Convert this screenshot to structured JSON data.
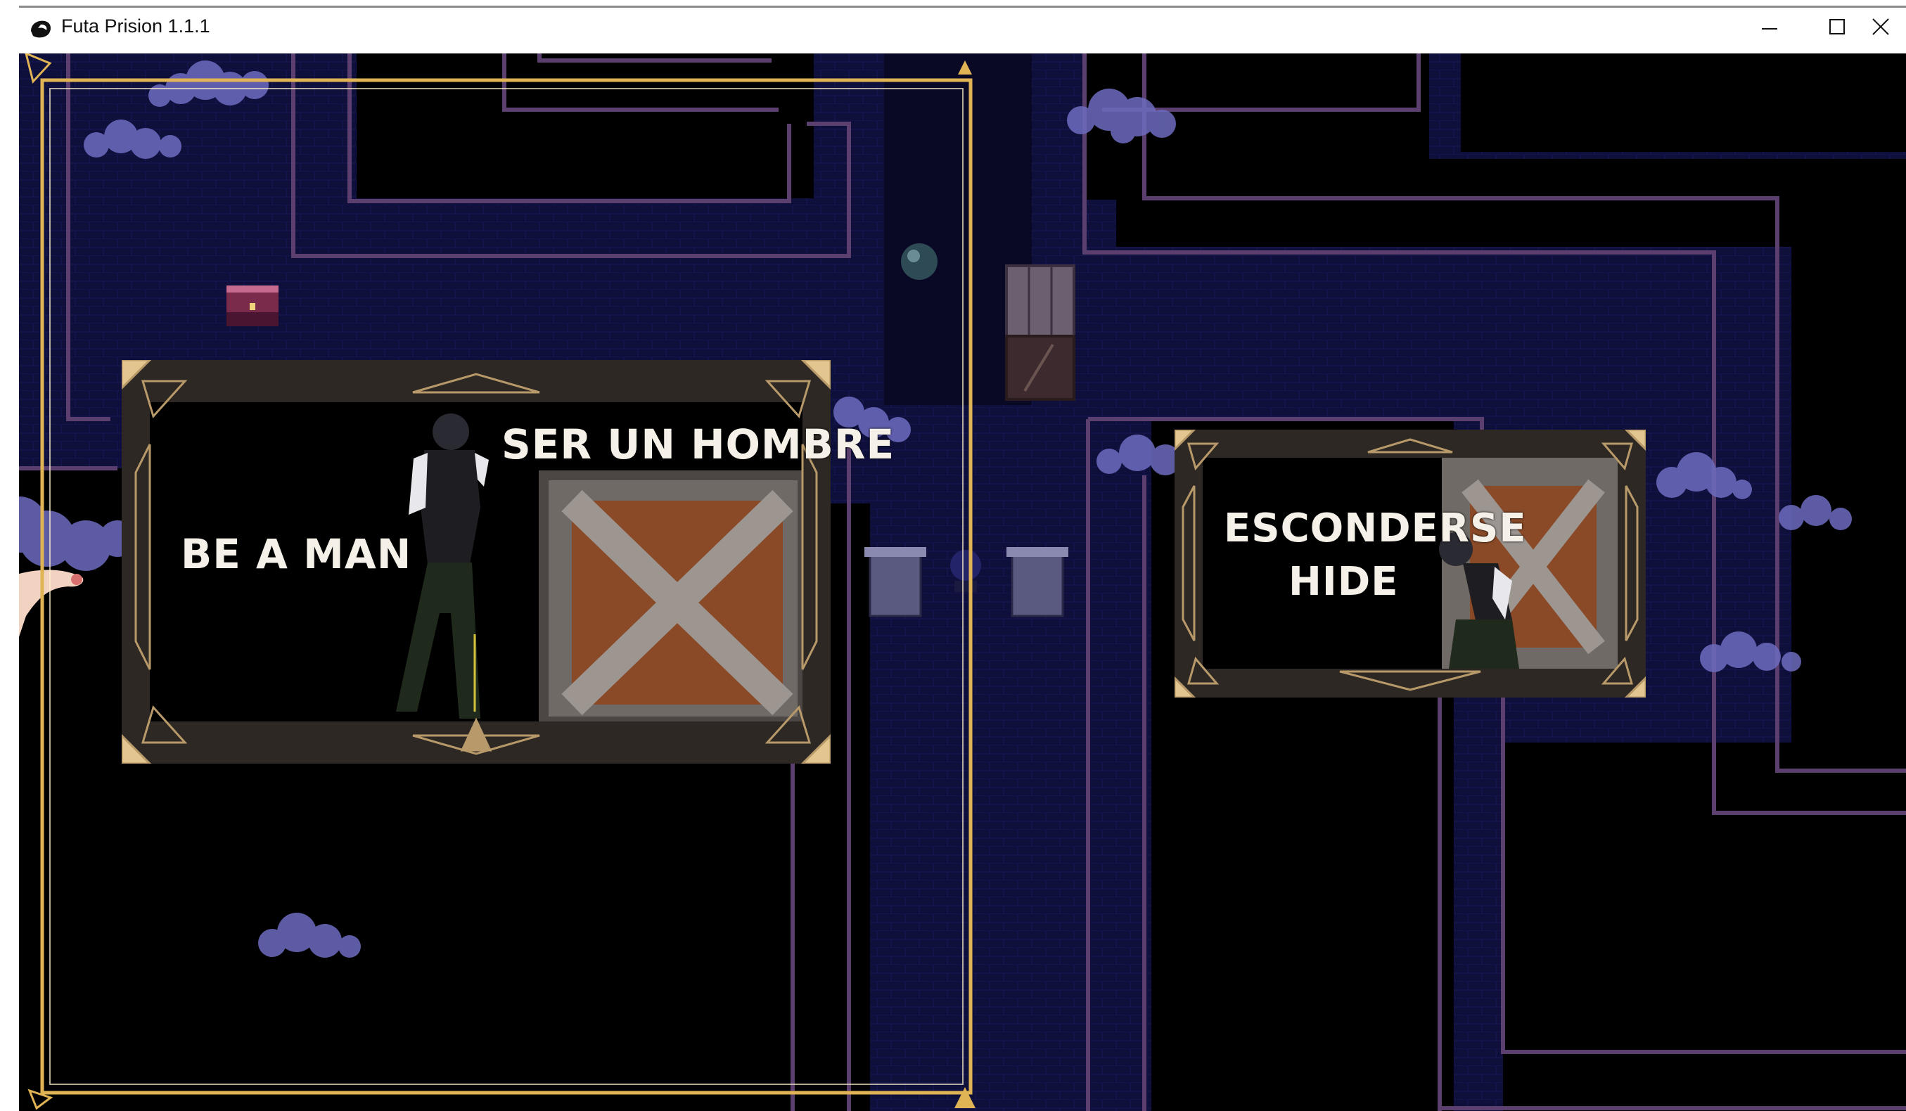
{
  "window": {
    "title": "Futa Prision 1.1.1",
    "icon": "app-blob-icon",
    "controls": [
      "minimize-icon",
      "maximize-icon",
      "close-icon"
    ]
  },
  "choices": [
    {
      "id": "be_a_man",
      "label_es": "SER UN HOMBRE",
      "label_en": "BE A MAN"
    },
    {
      "id": "hide",
      "label_es": "ESCONDERSE",
      "label_en": "HIDE"
    }
  ],
  "colors": {
    "floor": "#0e0e3a",
    "void": "#000000",
    "wall_trim": "#5b3f6e",
    "selection_frame": "#e0b455",
    "card_frame": "#2e2824",
    "card_ornament": "#b89a6a",
    "label_text": "#f5f1e8"
  }
}
